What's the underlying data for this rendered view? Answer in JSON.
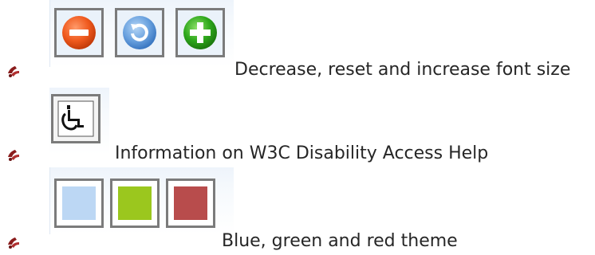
{
  "items": [
    {
      "caption": "Decrease, reset and increase font size",
      "buttons": [
        {
          "icon": "decrease-font-icon",
          "color": "#f05a1e"
        },
        {
          "icon": "reset-font-icon",
          "color": "#5a96dc"
        },
        {
          "icon": "increase-font-icon",
          "color": "#2ea81c"
        }
      ]
    },
    {
      "caption": "Information on W3C Disability Access Help",
      "buttons": [
        {
          "icon": "wheelchair-icon",
          "color": "#111111"
        }
      ]
    },
    {
      "caption": "Blue, green and red theme",
      "buttons": [
        {
          "icon": "blue-theme-swatch",
          "color": "#bcd7f4"
        },
        {
          "icon": "green-theme-swatch",
          "color": "#9bc71e"
        },
        {
          "icon": "red-theme-swatch",
          "color": "#b84c4c"
        }
      ]
    }
  ]
}
